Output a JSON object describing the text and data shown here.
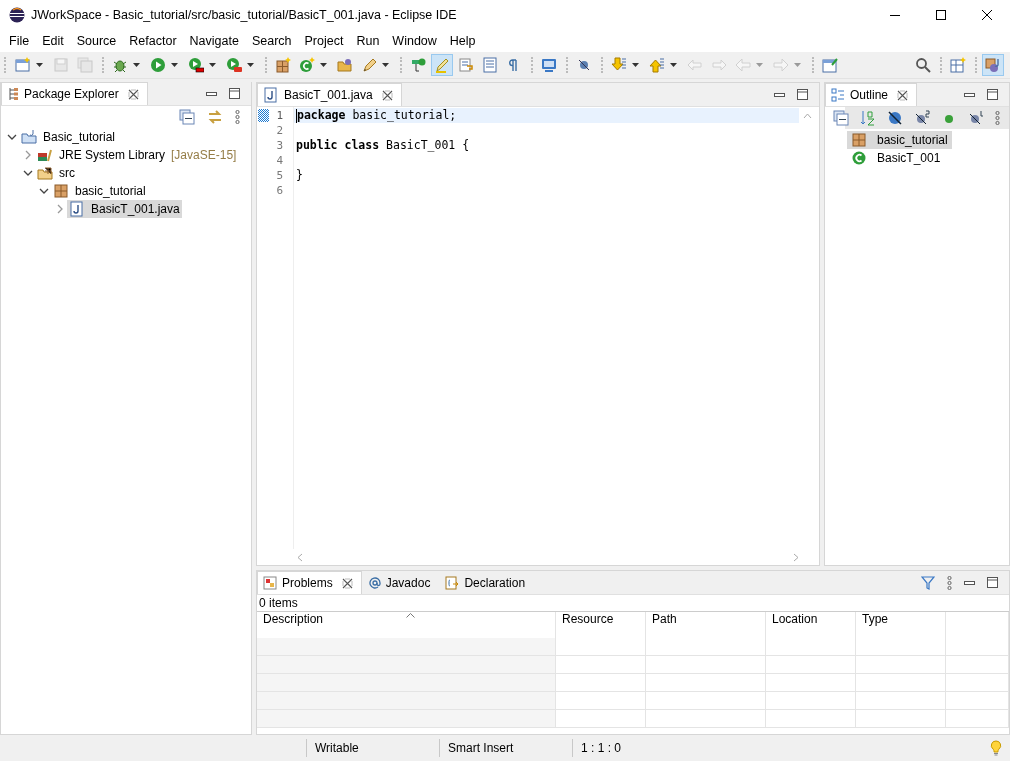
{
  "window": {
    "title": "JWorkSpace - Basic_tutorial/src/basic_tutorial/BasicT_001.java - Eclipse IDE"
  },
  "menu": [
    "File",
    "Edit",
    "Source",
    "Refactor",
    "Navigate",
    "Search",
    "Project",
    "Run",
    "Window",
    "Help"
  ],
  "toolbar": [
    {
      "selected": false,
      "disabled": false
    },
    {
      "selected": false,
      "disabled": true
    },
    {
      "selected": false,
      "disabled": true
    },
    {
      "selected": false,
      "disabled": false
    },
    {
      "selected": false,
      "disabled": false
    },
    {
      "selected": false,
      "disabled": false
    },
    {
      "selected": false,
      "disabled": false
    },
    {
      "selected": false,
      "disabled": false
    },
    {
      "selected": false,
      "disabled": false
    },
    {
      "selected": false,
      "disabled": false
    },
    {
      "selected": false,
      "disabled": false
    },
    {
      "selected": false,
      "disabled": false
    },
    {
      "selected": true,
      "disabled": false
    },
    {
      "selected": false,
      "disabled": false
    },
    {
      "selected": false,
      "disabled": false
    },
    {
      "selected": false,
      "disabled": false
    },
    {
      "selected": false,
      "disabled": false
    },
    {
      "selected": false,
      "disabled": false
    },
    {
      "selected": false,
      "disabled": false
    },
    {
      "selected": false,
      "disabled": false
    },
    {
      "selected": false,
      "disabled": true
    },
    {
      "selected": false,
      "disabled": true
    },
    {
      "selected": false,
      "disabled": true
    },
    {
      "selected": false,
      "disabled": true
    },
    {
      "selected": false,
      "disabled": false
    },
    {
      "selected": false,
      "disabled": false
    },
    {
      "selected": false,
      "disabled": false
    },
    {
      "selected": true,
      "disabled": false
    }
  ],
  "package_explorer": {
    "tab": {
      "label": "Package Explorer",
      "selected": true
    },
    "tree": [
      {
        "label": "Basic_tutorial",
        "kind": "project",
        "expanded": true,
        "selected": false,
        "children": [
          {
            "label": "JRE System Library",
            "decoration": "[JavaSE-15]",
            "kind": "library",
            "expanded": false,
            "selected": false
          },
          {
            "label": "src",
            "kind": "source-folder",
            "expanded": true,
            "selected": false,
            "children": [
              {
                "label": "basic_tutorial",
                "kind": "package",
                "expanded": true,
                "selected": false,
                "children": [
                  {
                    "label": "BasicT_001.java",
                    "kind": "java-file",
                    "expanded": false,
                    "selected": true
                  }
                ]
              }
            ]
          }
        ]
      }
    ]
  },
  "editor": {
    "tab": {
      "label": "BasicT_001.java",
      "selected": true
    },
    "lines": [
      {
        "number": "1",
        "code": "**package** basic_tutorial;",
        "current": true
      },
      {
        "number": "2",
        "current": false
      },
      {
        "number": "3",
        "code": "**public** **class** BasicT_001 {",
        "current": false
      },
      {
        "number": "4",
        "current": false
      },
      {
        "number": "5",
        "code": "}",
        "current": false
      },
      {
        "number": "6",
        "current": false
      }
    ]
  },
  "outline": {
    "tab": {
      "label": "Outline",
      "selected": true
    },
    "items": [
      {
        "label": "basic_tutorial",
        "kind": "package",
        "selected": true
      },
      {
        "label": "BasicT_001",
        "kind": "class",
        "selected": false
      }
    ]
  },
  "bottom_panel": {
    "tabs": [
      {
        "label": "Problems",
        "selected": true
      },
      {
        "label": "Javadoc",
        "selected": false
      },
      {
        "label": "Declaration",
        "selected": false
      }
    ],
    "summary": "0 items",
    "columns": [
      {
        "label": "Description",
        "sorted": true
      },
      {
        "label": "Resource",
        "sorted": false
      },
      {
        "label": "Path",
        "sorted": false
      },
      {
        "label": "Location",
        "sorted": false
      },
      {
        "label": "Type",
        "sorted": false
      }
    ]
  },
  "status_bar": [
    "Writable",
    "Smart Insert",
    "1 : 1 : 0"
  ]
}
